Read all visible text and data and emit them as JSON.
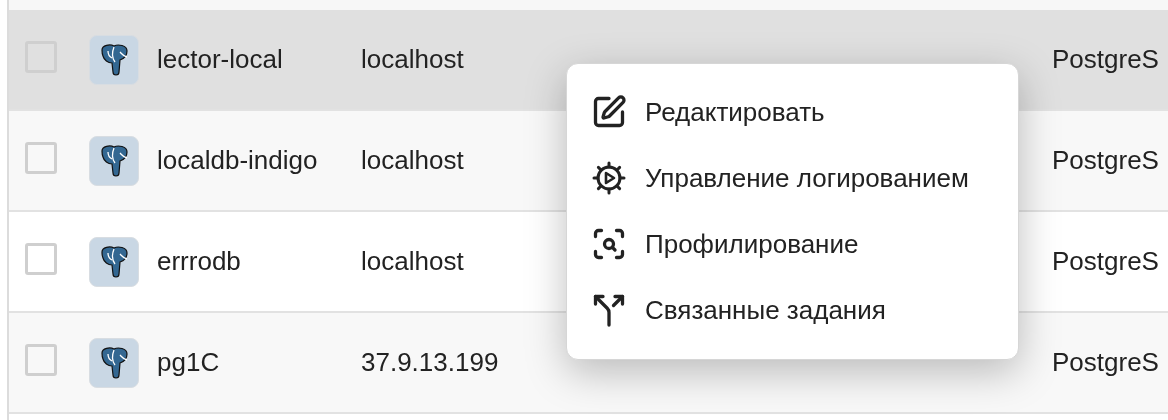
{
  "table": {
    "rows": [
      {
        "selected": true,
        "checked": false,
        "name": "lector-local",
        "host": "localhost",
        "type": "PostgreS"
      },
      {
        "selected": false,
        "checked": false,
        "name": "localdb-indigo",
        "host": "localhost",
        "type": "PostgreS"
      },
      {
        "selected": false,
        "checked": false,
        "name": "errrodb",
        "host": "localhost",
        "type": "PostgreS"
      },
      {
        "selected": false,
        "checked": false,
        "name": "pg1C",
        "host": "37.9.13.199",
        "type": "PostgreS"
      }
    ]
  },
  "context_menu": {
    "items": [
      {
        "kind": "edit",
        "label": "Редактировать"
      },
      {
        "kind": "logging",
        "label": "Управление логированием"
      },
      {
        "kind": "profiling",
        "label": "Профилирование"
      },
      {
        "kind": "related",
        "label": "Связанные задания"
      }
    ]
  }
}
